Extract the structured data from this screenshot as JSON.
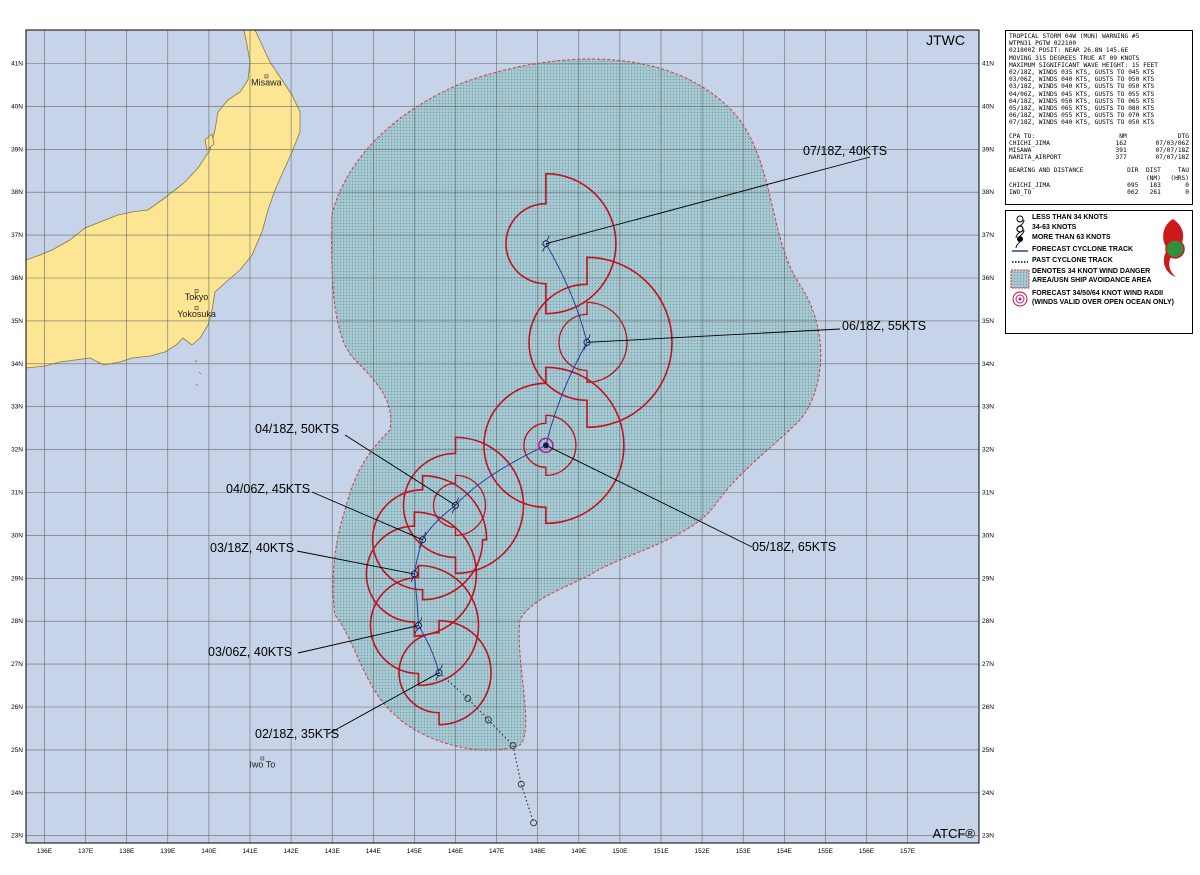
{
  "header": {
    "agency": "JTWC",
    "footer": "ATCF®"
  },
  "colors": {
    "water": "#c6d3e8",
    "land": "#fce694",
    "danger": "#a9c9d2",
    "radii": "#c0121f",
    "track": "#2d3ea0",
    "center": "#c0139f",
    "grid": "#6a6a6a"
  },
  "axes": {
    "lon_labels": [
      "136E",
      "137E",
      "138E",
      "139E",
      "140E",
      "141E",
      "142E",
      "143E",
      "144E",
      "145E",
      "146E",
      "147E",
      "148E",
      "149E",
      "150E",
      "151E",
      "152E",
      "153E",
      "154E",
      "155E",
      "156E",
      "157E"
    ],
    "lat_labels": [
      "23N",
      "24N",
      "25N",
      "26N",
      "27N",
      "28N",
      "29N",
      "30N",
      "31N",
      "32N",
      "33N",
      "34N",
      "35N",
      "36N",
      "37N",
      "38N",
      "39N",
      "40N",
      "41N"
    ]
  },
  "places": [
    {
      "name": "Misawa",
      "lon": 141.4,
      "lat": 40.7
    },
    {
      "name": "Tokyo",
      "lon": 139.7,
      "lat": 35.7
    },
    {
      "name": "Yokosuka",
      "lon": 139.7,
      "lat": 35.3
    },
    {
      "name": "Iwo To",
      "lon": 141.3,
      "lat": 24.8
    }
  ],
  "forecast_points": [
    {
      "label": "02/18Z, 35KTS",
      "lon": 145.6,
      "lat": 26.8
    },
    {
      "label": "03/06Z, 40KTS",
      "lon": 145.1,
      "lat": 27.9
    },
    {
      "label": "03/18Z, 40KTS",
      "lon": 145.0,
      "lat": 29.1
    },
    {
      "label": "04/06Z, 45KTS",
      "lon": 145.2,
      "lat": 29.9
    },
    {
      "label": "04/18Z, 50KTS",
      "lon": 146.0,
      "lat": 30.7
    },
    {
      "label": "05/18Z, 65KTS",
      "lon": 148.2,
      "lat": 32.1
    },
    {
      "label": "06/18Z, 55KTS",
      "lon": 149.2,
      "lat": 34.5
    },
    {
      "label": "07/18Z, 40KTS",
      "lon": 148.2,
      "lat": 36.8
    }
  ],
  "past_track": [
    {
      "lon": 145.6,
      "lat": 26.8
    },
    {
      "lon": 146.3,
      "lat": 26.2
    },
    {
      "lon": 146.8,
      "lat": 25.7
    },
    {
      "lon": 147.4,
      "lat": 25.1
    },
    {
      "lon": 147.6,
      "lat": 24.2
    },
    {
      "lon": 147.9,
      "lat": 23.3
    }
  ],
  "info": {
    "lines": [
      "TROPICAL STORM 04W (MUN) WARNING #5",
      "WTPN31 PGTW 022100",
      "021800Z POSIT: NEAR 26.8N 145.6E",
      "MOVING 315 DEGREES TRUE AT 09 KNOTS",
      "MAXIMUM SIGNIFICANT WAVE HEIGHT: 15 FEET",
      "02/18Z, WINDS 035 KTS, GUSTS TO 045 KTS",
      "03/06Z, WINDS 040 KTS, GUSTS TO 050 KTS",
      "03/18Z, WINDS 040 KTS, GUSTS TO 050 KTS",
      "04/06Z, WINDS 045 KTS, GUSTS TO 055 KTS",
      "04/18Z, WINDS 050 KTS, GUSTS TO 065 KTS",
      "05/18Z, WINDS 065 KTS, GUSTS TO 080 KTS",
      "06/18Z, WINDS 055 KTS, GUSTS TO 070 KTS",
      "07/18Z, WINDS 040 KTS, GUSTS TO 050 KTS"
    ],
    "cpa_header": [
      "CPA TO:",
      "NM",
      "DTG"
    ],
    "cpa_rows": [
      [
        "CHICHI_JIMA",
        "162",
        "07/03/06Z"
      ],
      [
        "MISAWA",
        "391",
        "07/07/18Z"
      ],
      [
        "NARITA_AIRPORT",
        "377",
        "07/07/18Z"
      ]
    ],
    "bearing_header": [
      "BEARING AND DISTANCE",
      "DIR",
      "DIST",
      "TAU"
    ],
    "bearing_sub": [
      "",
      "",
      "(NM)",
      "(HRS)"
    ],
    "bearing_rows": [
      [
        "CHICHI_JIMA",
        "095",
        "183",
        "0"
      ],
      [
        "IWO_TO",
        "062",
        "261",
        "0"
      ]
    ]
  },
  "legend": {
    "items": [
      "LESS THAN 34 KNOTS",
      "34-63 KNOTS",
      "MORE THAN 63 KNOTS",
      "FORECAST CYCLONE TRACK",
      "PAST CYCLONE TRACK",
      "DENOTES 34 KNOT WIND DANGER",
      "AREA/USN SHIP AVOIDANCE AREA",
      "FORECAST 34/50/64 KNOT WIND RADII",
      "(WINDS VALID OVER OPEN OCEAN ONLY)"
    ]
  }
}
